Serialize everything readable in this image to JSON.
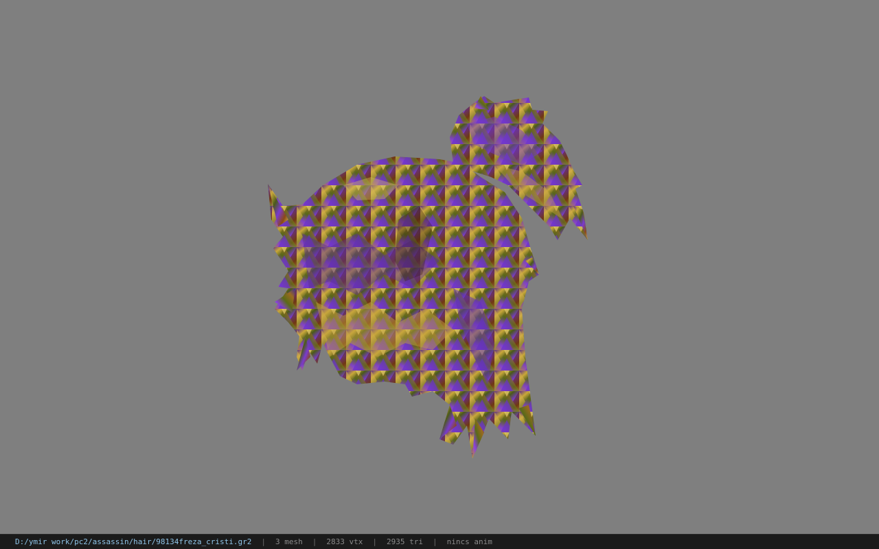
{
  "viewport": {
    "background": "#7f7f7f",
    "model_name": "hair-mesh-model"
  },
  "statusbar": {
    "file_path": "D:/ymir work/pc2/assassin/hair/98134freza_cristi.gr2",
    "separator": "|",
    "mesh_count": "3 mesh",
    "vertex_count": "2833 vtx",
    "triangle_count": "2935 tri",
    "anim_status": "nincs anim"
  },
  "colors": {
    "path_text": "#8fc4e8",
    "stat_text": "#8a8a8a",
    "statusbar_bg": "#1b1b1b"
  }
}
